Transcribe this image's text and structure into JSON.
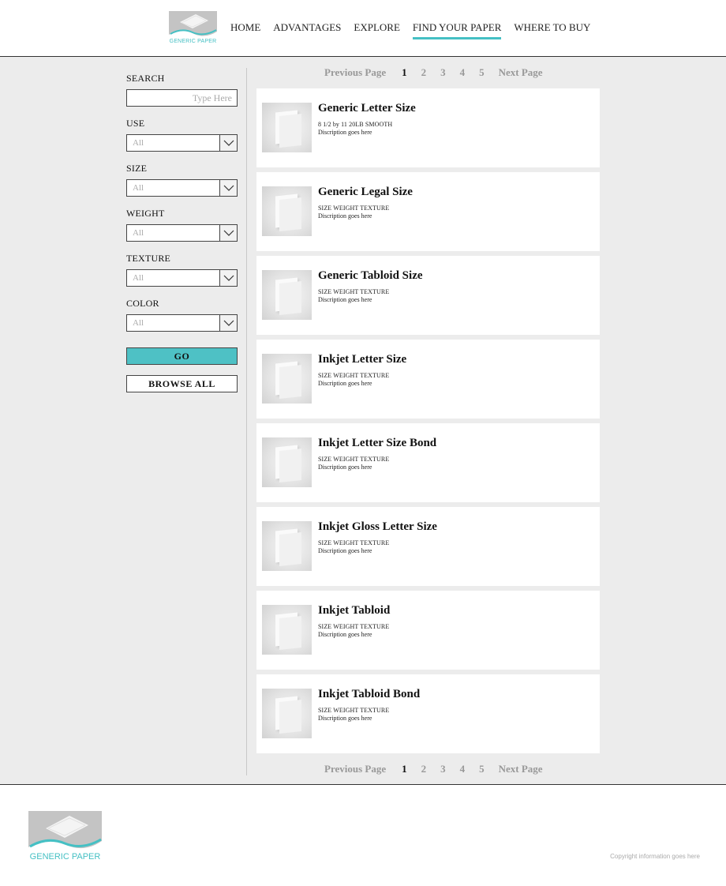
{
  "brand": {
    "name": "GENERIC PAPER",
    "accent_color": "#45c0c4"
  },
  "nav": {
    "items": [
      {
        "label": "HOME",
        "active": false
      },
      {
        "label": "ADVANTAGES",
        "active": false
      },
      {
        "label": "EXPLORE",
        "active": false
      },
      {
        "label": "FIND YOUR PAPER",
        "active": true
      },
      {
        "label": "WHERE TO BUY",
        "active": false
      }
    ]
  },
  "filters": {
    "search": {
      "label": "SEARCH",
      "placeholder": "Type Here"
    },
    "use": {
      "label": "USE",
      "value": "All"
    },
    "size": {
      "label": "SIZE",
      "value": "All"
    },
    "weight": {
      "label": "WEIGHT",
      "value": "All"
    },
    "texture": {
      "label": "TEXTURE",
      "value": "All"
    },
    "color": {
      "label": "COLOR",
      "value": "All"
    },
    "go_label": "GO",
    "browse_label": "BROWSE ALL"
  },
  "pagination": {
    "prev_label": "Previous Page",
    "next_label": "Next Page",
    "pages": [
      "1",
      "2",
      "3",
      "4",
      "5"
    ],
    "current": "1"
  },
  "products": [
    {
      "title": "Generic Letter Size",
      "specs": "8 1/2 by 11 20LB SMOOTH",
      "description": "Discription goes here"
    },
    {
      "title": "Generic Legal Size",
      "specs": "SIZE WEIGHT TEXTURE",
      "description": "Discription goes here"
    },
    {
      "title": "Generic Tabloid Size",
      "specs": "SIZE WEIGHT TEXTURE",
      "description": "Discription goes here"
    },
    {
      "title": "Inkjet Letter Size",
      "specs": "SIZE WEIGHT TEXTURE",
      "description": "Discription goes here"
    },
    {
      "title": "Inkjet Letter Size Bond",
      "specs": "SIZE WEIGHT TEXTURE",
      "description": "Discription goes here"
    },
    {
      "title": "Inkjet Gloss Letter Size",
      "specs": "SIZE WEIGHT TEXTURE",
      "description": "Discription goes here"
    },
    {
      "title": "Inkjet Tabloid",
      "specs": "SIZE WEIGHT TEXTURE",
      "description": "Discription goes here"
    },
    {
      "title": "Inkjet Tabloid Bond",
      "specs": "SIZE WEIGHT TEXTURE",
      "description": "Discription goes here"
    }
  ],
  "footer": {
    "copyright": "Copyright information goes here"
  }
}
